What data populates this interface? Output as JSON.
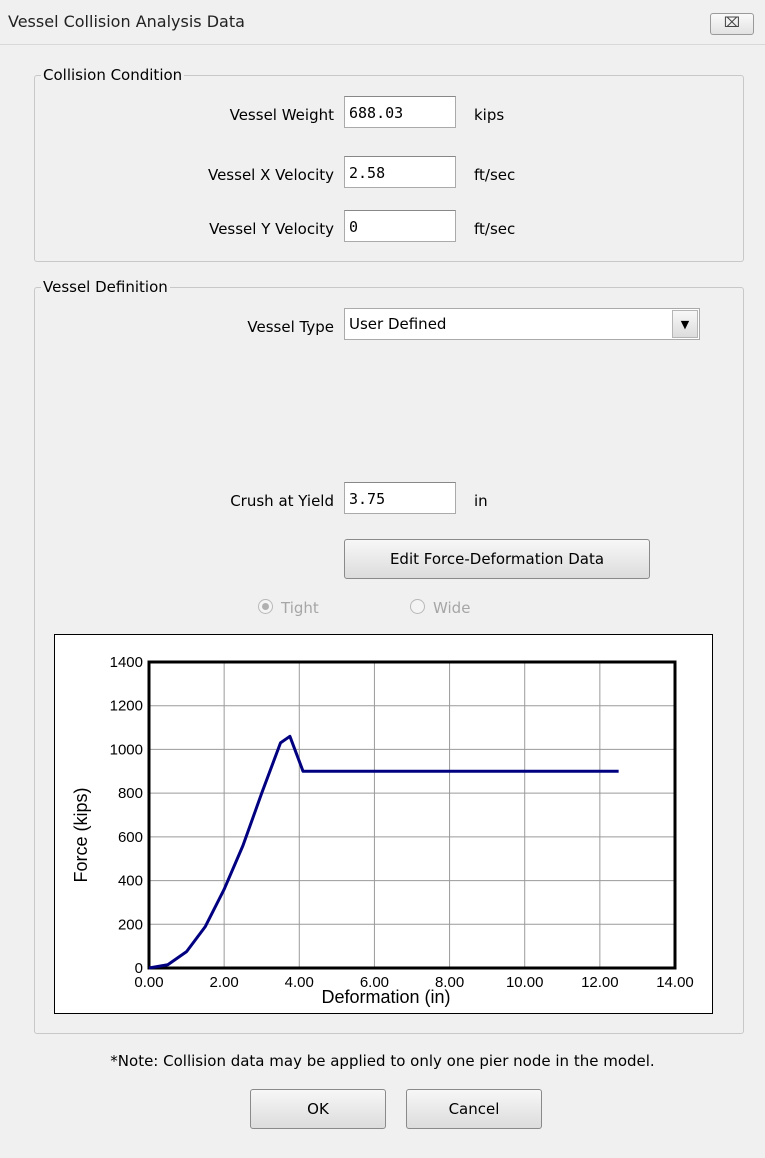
{
  "window": {
    "title": "Vessel Collision Analysis Data",
    "close_glyph": "⌧"
  },
  "collision_condition": {
    "legend": "Collision Condition",
    "weight_label": "Vessel Weight",
    "weight_value": "688.03",
    "weight_unit": "kips",
    "xvel_label": "Vessel X Velocity",
    "xvel_value": "2.58",
    "xvel_unit": "ft/sec",
    "yvel_label": "Vessel Y Velocity",
    "yvel_value": "0",
    "yvel_unit": "ft/sec"
  },
  "vessel_definition": {
    "legend": "Vessel Definition",
    "type_label": "Vessel Type",
    "type_value": "User Defined",
    "crush_label": "Crush at Yield",
    "crush_value": "3.75",
    "crush_unit": "in",
    "edit_button": "Edit Force-Deformation Data",
    "radio_tight": "Tight",
    "radio_wide": "Wide",
    "radio_selected": "Tight"
  },
  "chart_data": {
    "type": "line",
    "xlabel": "Deformation (in)",
    "ylabel": "Force (kips)",
    "xlim": [
      0,
      14
    ],
    "ylim": [
      0,
      1400
    ],
    "x_ticks": [
      "0.00",
      "2.00",
      "4.00",
      "6.00",
      "8.00",
      "10.00",
      "12.00",
      "14.00"
    ],
    "y_ticks": [
      "0",
      "200",
      "400",
      "600",
      "800",
      "1000",
      "1200",
      "1400"
    ],
    "grid": true,
    "line_color": "#000080",
    "series": [
      {
        "x": [
          0,
          0.5,
          1.0,
          1.5,
          2.0,
          2.5,
          3.0,
          3.5,
          3.75,
          4.1,
          4.2,
          12.5
        ],
        "y": [
          0,
          15,
          75,
          190,
          360,
          560,
          800,
          1030,
          1060,
          900,
          900,
          900
        ]
      }
    ]
  },
  "note": "*Note: Collision data may be applied to only one pier node in the model.",
  "buttons": {
    "ok": "OK",
    "cancel": "Cancel"
  }
}
